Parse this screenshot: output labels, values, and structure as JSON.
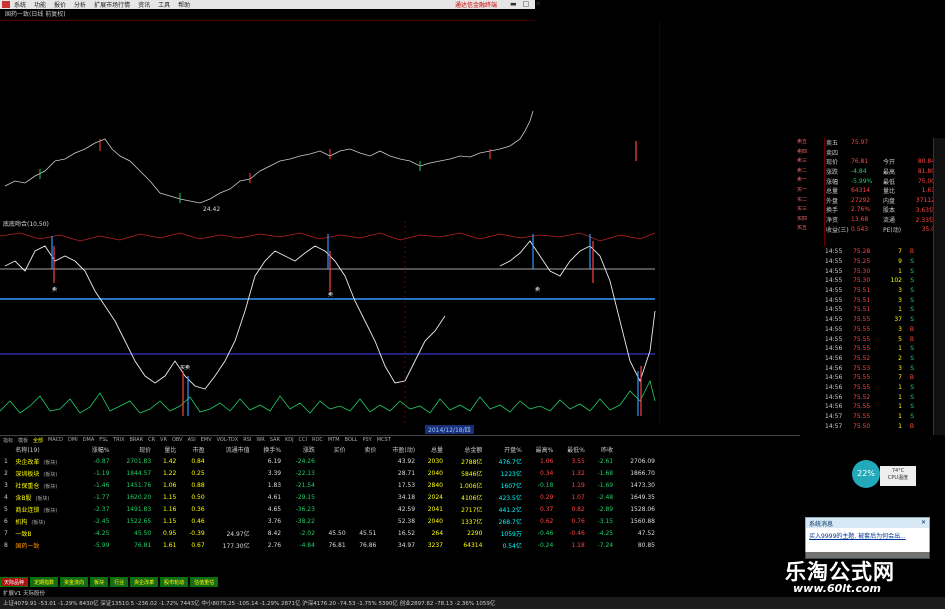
{
  "menu": {
    "items": [
      "系统",
      "功能",
      "报价",
      "分析",
      "扩展市场行情",
      "资讯",
      "工具",
      "帮助"
    ],
    "promo": "通达信金融终端"
  },
  "chart_title": "国药一致(日线 前复权)",
  "indicator_label": "底底吻合(10,50)",
  "macd_tabs": [
    "指标",
    "模板",
    "全部",
    "MACD",
    "DMI",
    "DMA",
    "FSL",
    "TRIX",
    "BRAR",
    "CR",
    "VR",
    "OBV",
    "ASI",
    "EMV",
    "VOL-TDX",
    "RSI",
    "WR",
    "SAR",
    "KDJ",
    "CCI",
    "ROC",
    "MTM",
    "BOLL",
    "PSY",
    "MCST"
  ],
  "date_label": "2014/12/18/四",
  "low_price_label": "24.42",
  "table": {
    "headers": [
      "",
      "名称(19)",
      "涨幅%",
      "现价",
      "量比",
      "市盈",
      "流通市值",
      "换手%",
      "涨跌",
      "买价",
      "卖价",
      "市盈(动)",
      "总量",
      "总金额",
      "开盘%",
      "最高%",
      "最低%",
      "昨收"
    ],
    "rows": [
      {
        "idx": "1",
        "name": "央企改革",
        "tag": "(板块)",
        "cells": [
          "-0.87",
          "2701.83",
          "1.42",
          "0.84",
          "",
          "6.19",
          "-24.26",
          "",
          "",
          "43.92",
          "2030",
          "2788亿",
          "476.7亿",
          "1.06",
          "3.55",
          "-2.61",
          "2706.09"
        ]
      },
      {
        "idx": "2",
        "name": "深圳板块",
        "tag": "(板块)",
        "cells": [
          "-1.19",
          "1844.57",
          "1.22",
          "0.25",
          "",
          "3.39",
          "-22.13",
          "",
          "",
          "28.71",
          "2040",
          "5846亿",
          "1223亿",
          "0.34",
          "1.32",
          "-1.68",
          "1866.70"
        ]
      },
      {
        "idx": "3",
        "name": "社保重仓",
        "tag": "(板块)",
        "cells": [
          "-1.46",
          "1451.76",
          "1.06",
          "0.88",
          "",
          "1.83",
          "-21.54",
          "",
          "",
          "17.53",
          "2840",
          "1.006亿",
          "1607亿",
          "-0.18",
          "1.19",
          "-1.69",
          "1473.30"
        ]
      },
      {
        "idx": "4",
        "name": "含B股",
        "tag": "(板块)",
        "cells": [
          "-1.77",
          "1620.20",
          "1.15",
          "0.50",
          "",
          "4.61",
          "-29.15",
          "",
          "",
          "34.18",
          "2024",
          "4106亿",
          "423.5亿",
          "0.29",
          "1.07",
          "-2.48",
          "1649.35"
        ]
      },
      {
        "idx": "5",
        "name": "商业连锁",
        "tag": "(板块)",
        "cells": [
          "-2.37",
          "1491.83",
          "1.16",
          "0.36",
          "",
          "4.65",
          "-36.23",
          "",
          "",
          "42.59",
          "2041",
          "2717亿",
          "441.2亿",
          "0.37",
          "0.82",
          "-2.89",
          "1528.06"
        ]
      },
      {
        "idx": "6",
        "name": "机构",
        "tag": "(板块)",
        "cells": [
          "-2.45",
          "1522.65",
          "1.15",
          "0.46",
          "",
          "3.76",
          "-38.22",
          "",
          "",
          "52.38",
          "2040",
          "1337亿",
          "268.7亿",
          "0.62",
          "0.76",
          "-3.15",
          "1560.88"
        ]
      },
      {
        "idx": "7",
        "name": "一致B",
        "tag": "",
        "cells": [
          "-4.25",
          "45.50",
          "0.95",
          "-0.39",
          "24.97亿",
          "8.42",
          "-2.02",
          "45.50",
          "45.51",
          "16.52",
          "264",
          "2290",
          "1059万",
          "-0.46",
          "-0.46",
          "-4.25",
          "47.52"
        ]
      },
      {
        "idx": "8",
        "name": "国药一致",
        "tag": "",
        "cells": [
          "-5.99",
          "76.81",
          "1.61",
          "0.67",
          "177.30亿",
          "2.76",
          "-4.84",
          "76.81",
          "76.86",
          "34.97",
          "3237",
          "64314",
          "0.54亿",
          "-0.24",
          "1.18",
          "-7.24",
          "80.85"
        ]
      }
    ]
  },
  "bottom_tabs": [
    "天际品种",
    "定期指数",
    "资金流向",
    "板块",
    "行业",
    "央企改革",
    "股市轮动",
    "估值重估"
  ],
  "statusbar": "上证4079.91  -53.01  -1.29%  8430亿  深证13510.5  -236.02  -1.72%  7443亿  中小8075.25  -105.14  -1.29%  2871亿  沪深4176.20  -74.53  -1.75%  5390亿  创业2897.82  -78.13  -2.36%  1059亿",
  "statusbar_left": "扩展V1  天际股份",
  "quote": {
    "rows": [
      {
        "label": "卖五",
        "v1": "75.97",
        "v2": "5",
        "k2": "",
        "v3": ""
      },
      {
        "label": "卖四",
        "v1": "",
        "v2": "",
        "k2": "",
        "v3": ""
      },
      {
        "label": "现价",
        "v1": "76.81",
        "k2": "今开",
        "v3": "80.84"
      },
      {
        "label": "涨跌",
        "v1": "-4.84",
        "k2": "最高",
        "v3": "81.80"
      },
      {
        "label": "涨幅",
        "v1": "-5.99%",
        "k2": "最低",
        "v3": "75.00"
      },
      {
        "label": "总量",
        "v1": "64314",
        "k2": "量比",
        "v3": "1.61"
      },
      {
        "label": "外盘",
        "v1": "27292",
        "k2": "内盘",
        "v3": "37112"
      },
      {
        "label": "换手",
        "v1": "2.76%",
        "k2": "股本",
        "v3": "3.63亿"
      },
      {
        "label": "净资",
        "v1": "13.68",
        "k2": "流通",
        "v3": "2.33亿"
      },
      {
        "label": "收益(三)",
        "v1": "0.543",
        "k2": "PE(动)",
        "v3": "35.0"
      }
    ]
  },
  "ticks": [
    {
      "t": "14:55",
      "p": "75.28",
      "v": "7",
      "s": "B"
    },
    {
      "t": "14:55",
      "p": "75.25",
      "v": "9",
      "s": "S"
    },
    {
      "t": "14:55",
      "p": "75.30",
      "v": "1",
      "s": "S"
    },
    {
      "t": "14:55",
      "p": "75.30",
      "v": "102",
      "s": "S"
    },
    {
      "t": "14:55",
      "p": "75.51",
      "v": "3",
      "s": "S"
    },
    {
      "t": "14:55",
      "p": "75.51",
      "v": "3",
      "s": "S"
    },
    {
      "t": "14:55",
      "p": "75.51",
      "v": "1",
      "s": "S"
    },
    {
      "t": "14:55",
      "p": "75.55",
      "v": "37",
      "s": "S"
    },
    {
      "t": "14:55",
      "p": "75.55",
      "v": "3",
      "s": "B"
    },
    {
      "t": "14:55",
      "p": "75.55",
      "v": "5",
      "s": "B"
    },
    {
      "t": "14:56",
      "p": "75.55",
      "v": "1",
      "s": "S"
    },
    {
      "t": "14:56",
      "p": "75.52",
      "v": "2",
      "s": "S"
    },
    {
      "t": "14:56",
      "p": "75.53",
      "v": "3",
      "s": "S"
    },
    {
      "t": "14:56",
      "p": "75.55",
      "v": "7",
      "s": "B"
    },
    {
      "t": "14:56",
      "p": "75.55",
      "v": "1",
      "s": "S"
    },
    {
      "t": "14:56",
      "p": "75.52",
      "v": "1",
      "s": "S"
    },
    {
      "t": "14:56",
      "p": "75.55",
      "v": "1",
      "s": "S"
    },
    {
      "t": "14:57",
      "p": "75.55",
      "v": "1",
      "s": "S"
    },
    {
      "t": "14:57",
      "p": "75.50",
      "v": "1",
      "s": "B"
    }
  ],
  "popup": {
    "title": "系统消息",
    "body": "买入9999的主题, 被套后为何会出..."
  },
  "cpu": {
    "percent": "22%",
    "temp": "74°C",
    "label": "CPU温度"
  },
  "watermark": {
    "line1": "乐淘公式网",
    "line2": "www.60lt.com"
  },
  "chart_markers": {
    "sell": "卖",
    "buy": "买",
    "buy_sell": "买卖"
  }
}
